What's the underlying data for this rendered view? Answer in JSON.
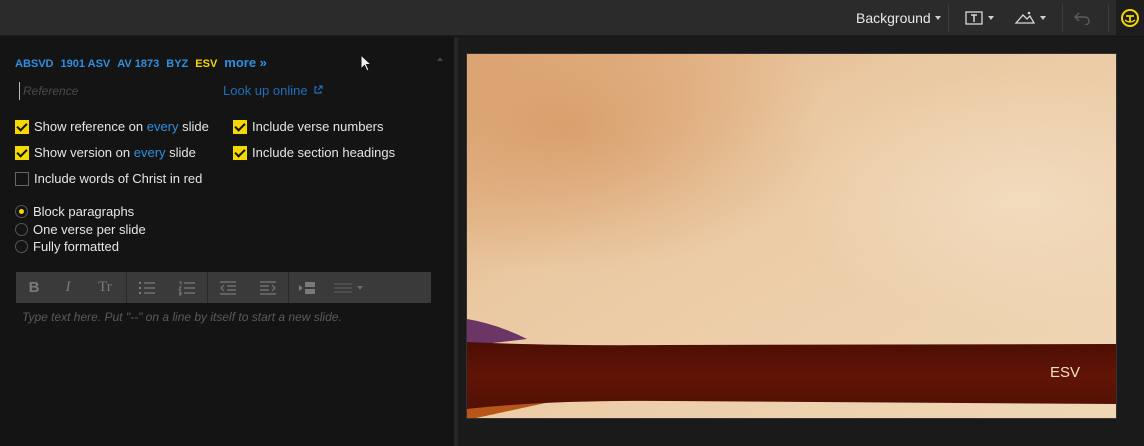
{
  "toolbar": {
    "background_label": "Background",
    "icons": [
      "text-layout-icon",
      "image-mountain-icon",
      "undo-icon",
      "logo-badge-icon"
    ]
  },
  "versions": {
    "items": [
      "ABSVD",
      "1901 ASV",
      "AV 1873",
      "BYZ",
      "ESV"
    ],
    "active": "ESV",
    "more": "more »"
  },
  "reference": {
    "placeholder": "Reference",
    "lookup_label": "Look up online"
  },
  "options": {
    "show_reference_pre": "Show reference on ",
    "show_reference_hl": "every",
    "show_reference_post": " slide",
    "show_version_pre": "Show version on ",
    "show_version_hl": "every",
    "show_version_post": " slide",
    "include_verse_numbers": "Include verse numbers",
    "include_section_headings": "Include section headings",
    "include_words_christ": "Include words of Christ in red"
  },
  "layout_options": {
    "block": "Block paragraphs",
    "one_verse": "One verse per slide",
    "fully": "Fully formatted",
    "selected": "Block paragraphs"
  },
  "editor": {
    "bold": "B",
    "italic": "I",
    "text_size": "Tr",
    "hint": "Type text here. Put \"--\" on a line by itself to start a new slide."
  },
  "slide": {
    "version_label": "ESV"
  },
  "colors": {
    "accent_yellow": "#f4d800",
    "link_blue": "#2f8fe0",
    "band_red": "#5c1206",
    "parchment": "#ecd2b0"
  }
}
